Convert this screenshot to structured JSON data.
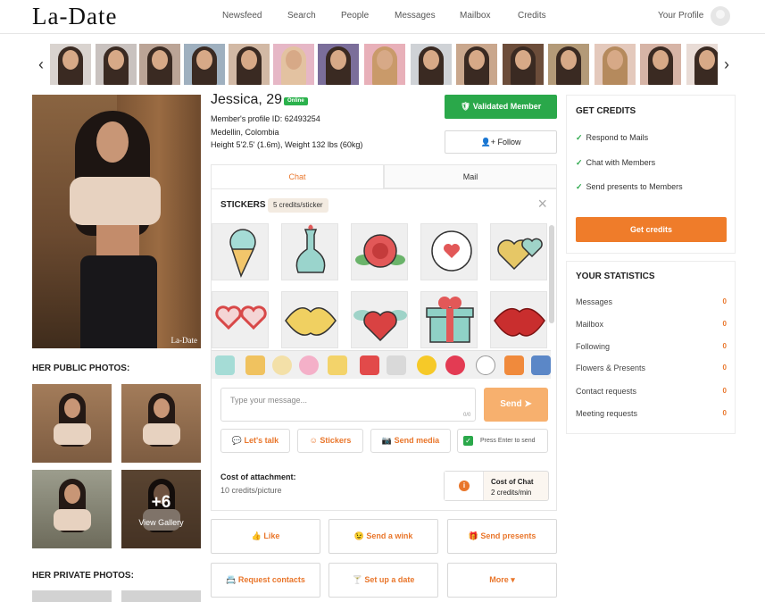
{
  "header": {
    "logo": "La-Date",
    "nav": [
      "Newsfeed",
      "Search",
      "People",
      "Messages",
      "Mailbox",
      "Credits"
    ],
    "profile_link": "Your Profile"
  },
  "profile": {
    "name_age": "Jessica, 29",
    "online_badge": "Online",
    "profile_id": "Member's profile ID: 62493254",
    "location": "Medellin, Colombia",
    "height_weight": "Height 5'2.5' (1.6m), Weight 132 lbs (60kg)",
    "photo_watermark": "La-Date",
    "validated_label": "Validated Member",
    "follow_label": "Follow"
  },
  "sections": {
    "public_photos": "HER PUBLIC PHOTOS:",
    "private_photos": "HER PRIVATE PHOTOS:",
    "gallery_count": "+6",
    "gallery_label": "View Gallery"
  },
  "chat": {
    "tabs": [
      "Chat",
      "Mail"
    ],
    "stickers_title": "STICKERS",
    "stickers_price": "5 credits/sticker",
    "sticker_names": [
      "ice-cream",
      "potion",
      "rose",
      "speech-heart",
      "two-hearts",
      "heart-glasses",
      "lips-yellow",
      "winged-heart",
      "gift-box",
      "lips-red"
    ],
    "message_placeholder": "Type your message...",
    "message_counter": "0/0",
    "send_label": "Send",
    "lets_talk": "Let's talk",
    "stickers_btn": "Stickers",
    "send_media": "Send media",
    "press_enter": "Press Enter to send",
    "cost_attachment_label": "Cost of attachment:",
    "cost_attachment_value": "10 credits/picture",
    "cost_chat_label": "Cost of Chat",
    "cost_chat_value": "2 credits/min"
  },
  "actions": [
    "Like",
    "Send a wink",
    "Send presents",
    "Request contacts",
    "Set up a date",
    "More"
  ],
  "credits_panel": {
    "title": "GET CREDITS",
    "items": [
      "Respond to Mails",
      "Chat with Members",
      "Send presents to Members"
    ],
    "button": "Get credits"
  },
  "stats_panel": {
    "title": "YOUR STATISTICS",
    "rows": [
      {
        "label": "Messages",
        "value": "0"
      },
      {
        "label": "Mailbox",
        "value": "0"
      },
      {
        "label": "Following",
        "value": "0"
      },
      {
        "label": "Flowers & Presents",
        "value": "0"
      },
      {
        "label": "Contact requests",
        "value": "0"
      },
      {
        "label": "Meeting requests",
        "value": "0"
      }
    ]
  },
  "colors": {
    "accent": "#ef7c2a",
    "validated": "#2aa84a",
    "online": "#2bb24c"
  }
}
